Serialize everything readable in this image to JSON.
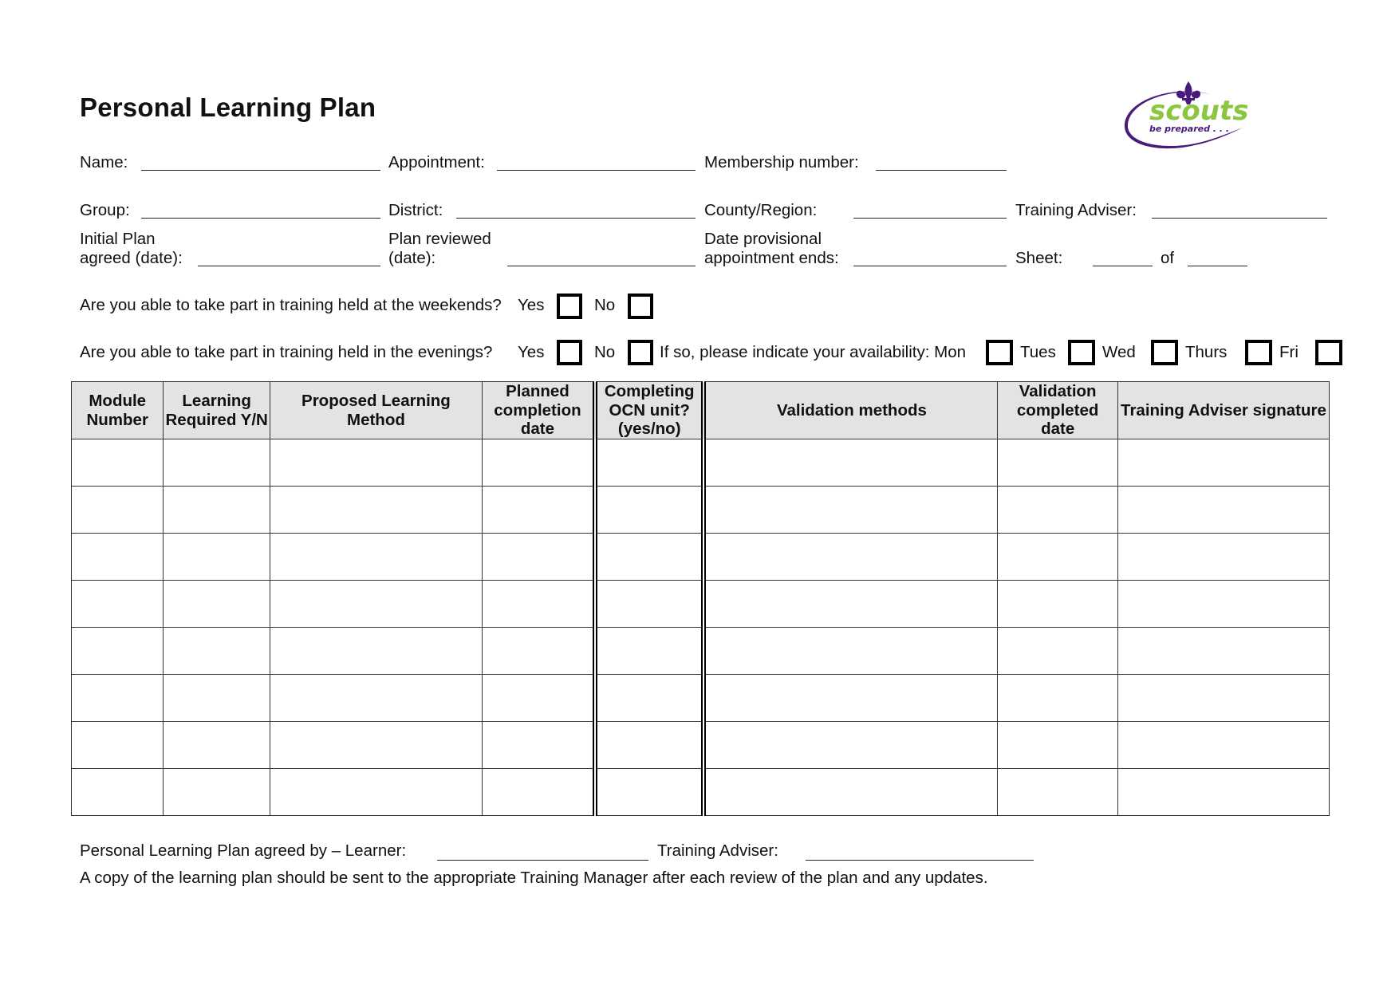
{
  "document": {
    "title": "Personal Learning Plan",
    "logo": {
      "wordmark": "scouts",
      "tagline": "be prepared . . .",
      "icon": "fleur-de-lis-icon",
      "colors": {
        "green": "#8cc63f",
        "purple": "#4a1a7a"
      }
    }
  },
  "fields": {
    "name": "Name:",
    "appointment": "Appointment:",
    "membership_number": "Membership number:",
    "group": "Group:",
    "district": "District:",
    "county_region": "County/Region:",
    "training_adviser": "Training Adviser:",
    "initial_plan_line1": "Initial Plan",
    "initial_plan_line2": "agreed (date):",
    "plan_reviewed_line1": "Plan reviewed",
    "plan_reviewed_line2": "(date):",
    "date_provisional_line1": "Date provisional",
    "date_provisional_line2": "appointment ends:",
    "sheet": "Sheet:",
    "of": "of"
  },
  "questions": {
    "weekends": "Are you able to take part in training held at the weekends?",
    "evenings": "Are you able to take part in training held in the evenings?",
    "yes": "Yes",
    "no": "No",
    "availability": "If so, please indicate your availability: Mon",
    "days": [
      "Tues",
      "Wed",
      "Thurs",
      "Fri"
    ]
  },
  "table": {
    "headers": [
      "Module Number",
      "Learning Required Y/N",
      "Proposed Learning Method",
      "Planned completion date",
      "Completing OCN unit? (yes/no)",
      "Validation methods",
      "Validation completed date",
      "Training Adviser signature"
    ],
    "row_count": 8
  },
  "footer": {
    "agreed_by": "Personal Learning Plan agreed by – Learner:",
    "training_adviser": "Training Adviser:",
    "note": "A copy of the learning plan should be sent to the appropriate Training Manager after each review of the plan and any updates."
  }
}
